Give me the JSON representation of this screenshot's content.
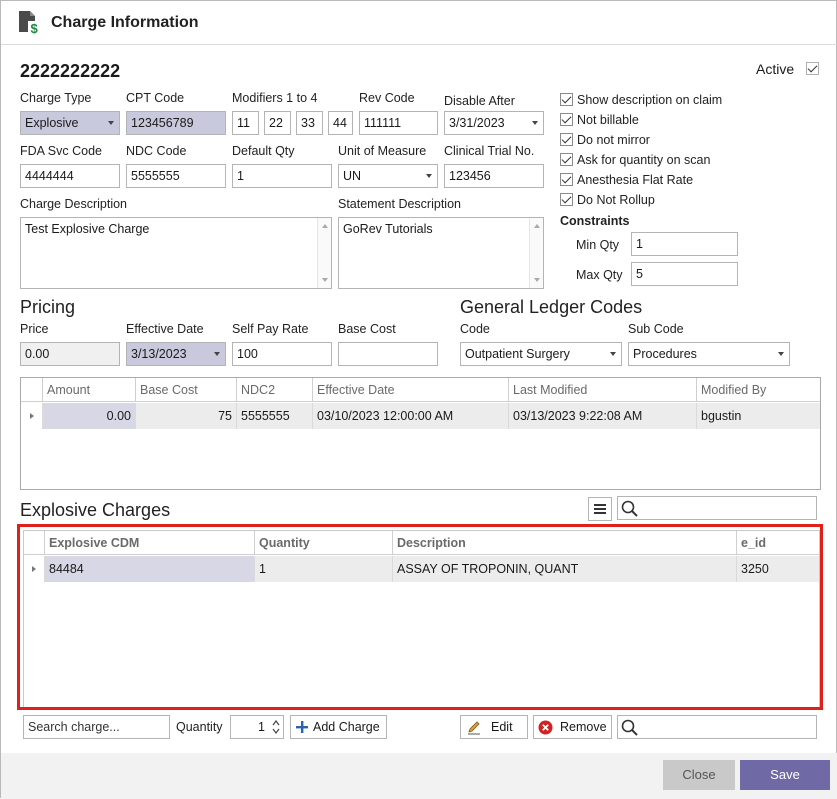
{
  "window": {
    "title": "Charge Information"
  },
  "charge": {
    "id": "2222222222",
    "active_label": "Active",
    "active_checked": true
  },
  "fields": {
    "charge_type": {
      "label": "Charge Type",
      "value": "Explosive"
    },
    "cpt_code": {
      "label": "CPT Code",
      "value": "123456789"
    },
    "modifiers": {
      "label": "Modifiers 1 to 4",
      "values": [
        "11",
        "22",
        "33",
        "44"
      ]
    },
    "rev_code": {
      "label": "Rev Code",
      "value": "111111"
    },
    "disable_after": {
      "label": "Disable After",
      "value": "3/31/2023"
    },
    "fda_svc_code": {
      "label": "FDA Svc Code",
      "value": "4444444"
    },
    "ndc_code": {
      "label": "NDC Code",
      "value": "5555555"
    },
    "default_qty": {
      "label": "Default Qty",
      "value": "1"
    },
    "unit_of_measure": {
      "label": "Unit of Measure",
      "value": "UN"
    },
    "clinical_trial": {
      "label": "Clinical Trial No.",
      "value": "123456"
    },
    "charge_description": {
      "label": "Charge Description",
      "value": "Test Explosive Charge"
    },
    "statement_description": {
      "label": "Statement Description",
      "value": "GoRev Tutorials"
    }
  },
  "options": [
    {
      "label": "Show description on claim",
      "checked": true
    },
    {
      "label": "Not billable",
      "checked": true
    },
    {
      "label": "Do not mirror",
      "checked": true
    },
    {
      "label": "Ask for quantity on scan",
      "checked": true
    },
    {
      "label": "Anesthesia Flat Rate",
      "checked": true
    },
    {
      "label": "Do Not Rollup",
      "checked": true
    }
  ],
  "constraints": {
    "title": "Constraints",
    "min_qty_label": "Min Qty",
    "min_qty": "1",
    "max_qty_label": "Max Qty",
    "max_qty": "5"
  },
  "pricing": {
    "title": "Pricing",
    "price_label": "Price",
    "price": "0.00",
    "effective_date_label": "Effective Date",
    "effective_date": "3/13/2023",
    "self_pay_label": "Self Pay Rate",
    "self_pay": "100",
    "base_cost_label": "Base Cost",
    "base_cost": ""
  },
  "ledger": {
    "title": "General Ledger Codes",
    "code_label": "Code",
    "code": "Outpatient Surgery",
    "sub_code_label": "Sub Code",
    "sub_code": "Procedures"
  },
  "pricing_grid": {
    "columns": [
      "Amount",
      "Base Cost",
      "NDC2",
      "Effective Date",
      "Last Modified",
      "Modified By"
    ],
    "rows": [
      [
        "0.00",
        "75",
        "5555555",
        "03/10/2023 12:00:00 AM",
        "03/13/2023 9:22:08 AM",
        "bgustin"
      ]
    ]
  },
  "explosive": {
    "title": "Explosive Charges",
    "columns": [
      "Explosive CDM",
      "Quantity",
      "Description",
      "e_id"
    ],
    "rows": [
      [
        "84484",
        "1",
        "ASSAY OF TROPONIN, QUANT",
        "3250"
      ]
    ],
    "search_placeholder": "Search charge...",
    "quantity_label": "Quantity",
    "quantity": "1",
    "add_label": "Add Charge",
    "edit_label": "Edit",
    "remove_label": "Remove"
  },
  "footer": {
    "close_label": "Close",
    "save_label": "Save"
  },
  "colors": {
    "highlight": "#e0201c",
    "save_button": "#6f6aa6",
    "selected_cell": "#d7d7e6"
  }
}
